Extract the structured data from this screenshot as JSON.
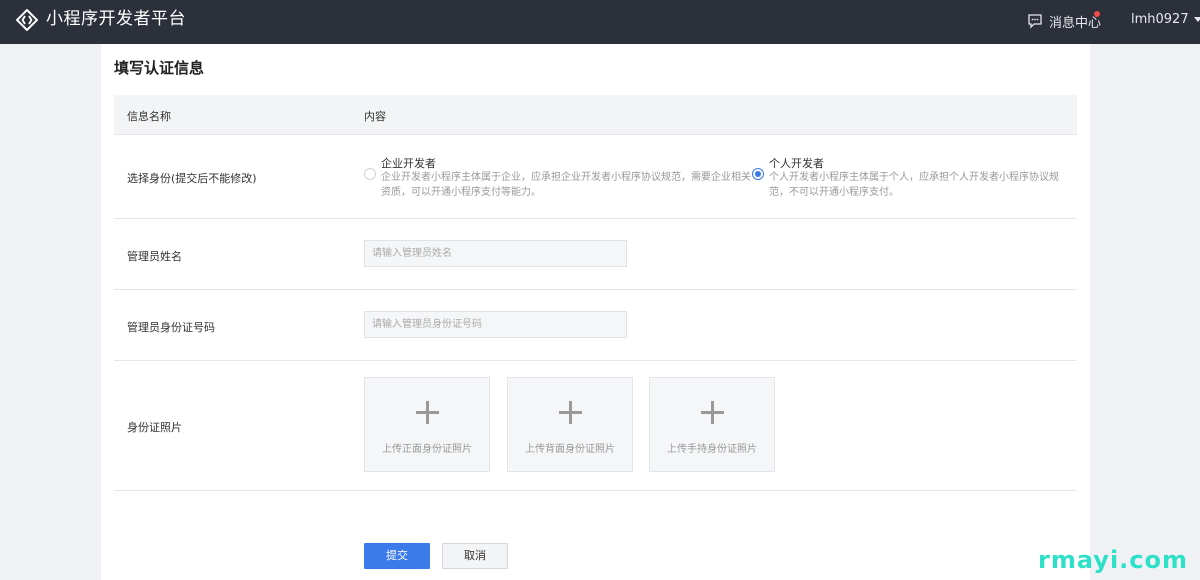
{
  "header": {
    "brand": "小程序开发者平台",
    "messages_label": "消息中心",
    "username": "lmh0927"
  },
  "page": {
    "title": "填写认证信息"
  },
  "table": {
    "col_name": "信息名称",
    "col_content": "内容"
  },
  "identity": {
    "label": "选择身份(提交后不能修改)",
    "options": [
      {
        "title": "企业开发者",
        "desc": "企业开发者小程序主体属于企业，应承担企业开发者小程序协议规范，需要企业相关资质，可以开通小程序支付等能力。",
        "selected": false
      },
      {
        "title": "个人开发者",
        "desc": "个人开发者小程序主体属于个人，应承担个人开发者小程序协议规范，不可以开通小程序支付。",
        "selected": true
      }
    ]
  },
  "admin_name": {
    "label": "管理员姓名",
    "placeholder": "请输入管理员姓名"
  },
  "admin_id": {
    "label": "管理员身份证号码",
    "placeholder": "请输入管理员身份证号码"
  },
  "id_photos": {
    "label": "身份证照片",
    "uploads": [
      "上传正面身份证照片",
      "上传背面身份证照片",
      "上传手持身份证照片"
    ]
  },
  "actions": {
    "submit": "提交",
    "cancel": "取消"
  },
  "watermark": "rmayi.com",
  "colors": {
    "topbar": "#2b303b",
    "accent": "#3b7ae9",
    "notification_dot": "#f24b4b"
  }
}
